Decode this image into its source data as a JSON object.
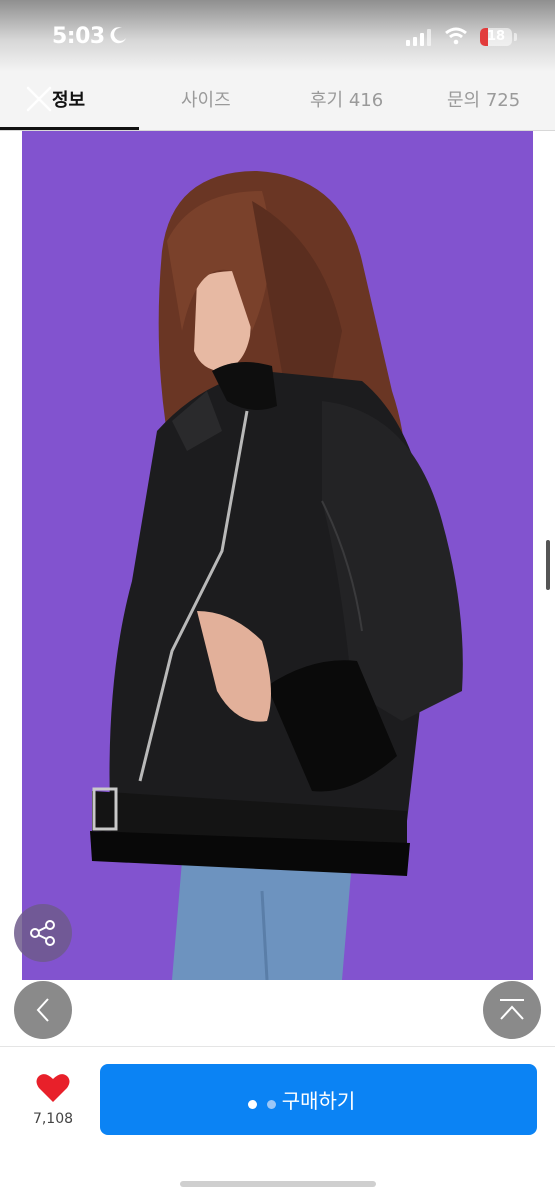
{
  "status": {
    "time": "5:03",
    "battery": "18"
  },
  "tabs": [
    {
      "label": "정보"
    },
    {
      "label": "사이즈"
    },
    {
      "label": "후기 416"
    },
    {
      "label": "문의 725"
    }
  ],
  "product": {
    "image_alt": ""
  },
  "bottom": {
    "like_count": "7,108",
    "buy_label": "구매하기"
  },
  "colors": {
    "accent": "#0b83f4",
    "background": "#8253cf",
    "like": "#e8202a"
  },
  "icons": [
    "close-icon",
    "share-icon",
    "chevron-left-icon",
    "scroll-top-icon",
    "heart-icon"
  ]
}
